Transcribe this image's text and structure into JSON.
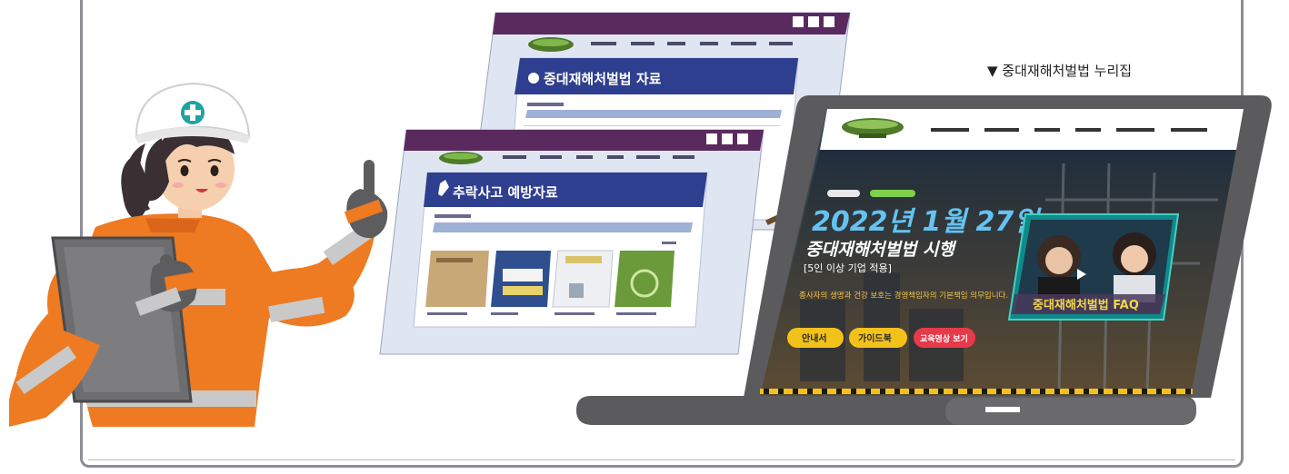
{
  "caption": "▼ 중대재해처벌법 누리집",
  "back_window": {
    "title_bar_color": "#5a2a5e",
    "header_color": "#2f3f8f",
    "banner_text": "중대재해처벌법 자료"
  },
  "front_window": {
    "title_bar_color": "#5a2a5e",
    "header_color": "#2f3f8f",
    "banner_text": "추락사고 예방자료"
  },
  "laptop": {
    "hero_title": "2022년 1월 27일",
    "hero_subtitle": "중대재해처벌법 시행",
    "hero_note": "[5인 이상 기업 적용]",
    "hero_desc": "종사자의 생명과 건강 보호는 경영책임자의 기본책임 의무입니다.",
    "video_caption": "중대재해처벌법 FAQ",
    "buttons": [
      "안내서",
      "가이드북",
      "교육영상 보기"
    ],
    "accent_yellow": "#f2c21b",
    "accent_red": "#e63a4a"
  },
  "worker": {
    "suit_color": "#ee7a22",
    "helmet_cross_color": "#1ea3a3"
  }
}
